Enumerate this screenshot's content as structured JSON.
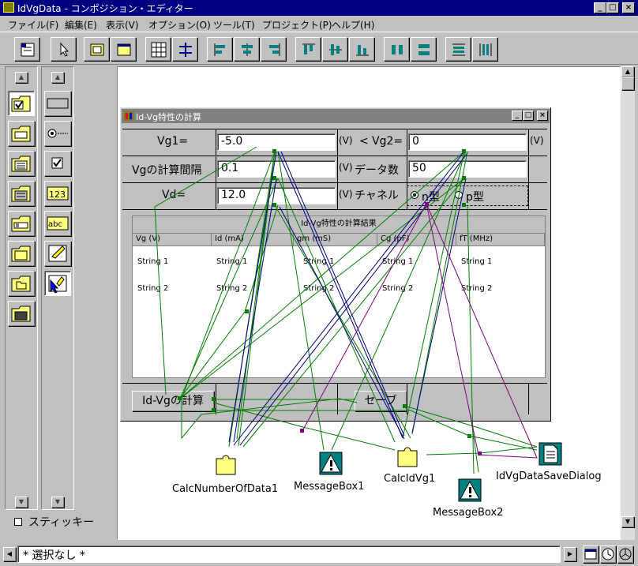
{
  "window": {
    "title": "IdVgData - コンポジション・エディター"
  },
  "menu": [
    "ファイル(F)",
    "編集(E)",
    "表示(V)",
    "オプション(O)",
    "ツール(T)",
    "プロジェクト(P)",
    "ヘルプ(H)"
  ],
  "form": {
    "title": "Id-Vg特性の計算",
    "vg1_label": "Vg1=",
    "vg1_value": "-5.0",
    "unit_v": "(V)",
    "lt": "<",
    "vg2_label": "Vg2=",
    "vg2_value": "0",
    "interval_label": "Vgの計算間隔",
    "interval_value": "0.1",
    "datacount_label": "データ数",
    "datacount_value": "50",
    "vd_label": "Vd=",
    "vd_value": "12.0",
    "channel_label": "チャネル",
    "channel_n": "n型",
    "channel_p": "p型",
    "table_title": "Id-Vg特性の計算結果",
    "columns": [
      "Vg (V)",
      "Id (mA)",
      "gm (mS)",
      "Cg (pF)",
      "fT (MHz)"
    ],
    "rows": [
      [
        "String 1",
        "String 1",
        "String 1",
        "String 1",
        "String 1"
      ],
      [
        "String 2",
        "String 2",
        "String 2",
        "String 2",
        "String 2"
      ]
    ],
    "calc_button": "Id-Vgの計算",
    "save_button": "セーブ"
  },
  "components": {
    "calc_data": "CalcNumberOfData1",
    "msgbox1": "MessageBox1",
    "calc_idvg": "CalcIdVg1",
    "msgbox2": "MessageBox2",
    "save_dialog": "IdVgDataSaveDialog"
  },
  "palette": {
    "sticky_label": "スティッキー"
  },
  "status": {
    "text": "* 選択なし *"
  },
  "colors": {
    "title_active": "#000080",
    "title_inactive": "#808080",
    "link_green": "#008000",
    "link_blue": "#000080",
    "link_purple": "#800080"
  }
}
